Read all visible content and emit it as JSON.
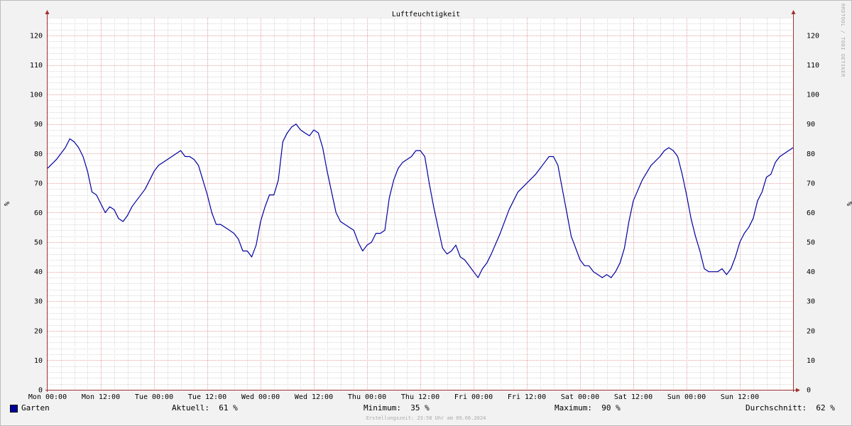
{
  "chart_data": {
    "type": "line",
    "title": "Luftfeuchtigkeit",
    "ylabel": "%",
    "ylim": [
      0,
      126
    ],
    "yticks": [
      0,
      10,
      20,
      30,
      40,
      50,
      60,
      70,
      80,
      90,
      100,
      110,
      120
    ],
    "x_tick_labels": [
      "Mon 00:00",
      "Mon 12:00",
      "Tue 00:00",
      "Tue 12:00",
      "Wed 00:00",
      "Wed 12:00",
      "Thu 00:00",
      "Thu 12:00",
      "Fri 00:00",
      "Fri 12:00",
      "Sat 00:00",
      "Sat 12:00",
      "Sun 00:00",
      "Sun 12:00"
    ],
    "x_unit": "hours since Mon 00:00",
    "xlim": [
      0,
      168
    ],
    "grid": true,
    "series": [
      {
        "name": "Garten",
        "color": "#0000a0",
        "points": [
          [
            0,
            75
          ],
          [
            2,
            78
          ],
          [
            4,
            82
          ],
          [
            5,
            85
          ],
          [
            6,
            84
          ],
          [
            7,
            82
          ],
          [
            8,
            79
          ],
          [
            9,
            74
          ],
          [
            10,
            67
          ],
          [
            11,
            66
          ],
          [
            12,
            63
          ],
          [
            13,
            60
          ],
          [
            14,
            62
          ],
          [
            15,
            61
          ],
          [
            16,
            58
          ],
          [
            17,
            57
          ],
          [
            18,
            59
          ],
          [
            19,
            62
          ],
          [
            20,
            64
          ],
          [
            22,
            68
          ],
          [
            24,
            74
          ],
          [
            25,
            76
          ],
          [
            27,
            78
          ],
          [
            29,
            80
          ],
          [
            30,
            81
          ],
          [
            31,
            79
          ],
          [
            32,
            79
          ],
          [
            33,
            78
          ],
          [
            34,
            76
          ],
          [
            35,
            71
          ],
          [
            36,
            66
          ],
          [
            37,
            60
          ],
          [
            38,
            56
          ],
          [
            39,
            56
          ],
          [
            40,
            55
          ],
          [
            41,
            54
          ],
          [
            42,
            53
          ],
          [
            43,
            51
          ],
          [
            44,
            47
          ],
          [
            45,
            47
          ],
          [
            46,
            45
          ],
          [
            47,
            49
          ],
          [
            48,
            57
          ],
          [
            49,
            62
          ],
          [
            50,
            66
          ],
          [
            51,
            66
          ],
          [
            52,
            71
          ],
          [
            53,
            84
          ],
          [
            54,
            87
          ],
          [
            55,
            89
          ],
          [
            56,
            90
          ],
          [
            57,
            88
          ],
          [
            58,
            87
          ],
          [
            59,
            86
          ],
          [
            60,
            88
          ],
          [
            61,
            87
          ],
          [
            62,
            82
          ],
          [
            63,
            74
          ],
          [
            64,
            67
          ],
          [
            65,
            60
          ],
          [
            66,
            57
          ],
          [
            67,
            56
          ],
          [
            68,
            55
          ],
          [
            69,
            54
          ],
          [
            70,
            50
          ],
          [
            71,
            47
          ],
          [
            72,
            49
          ],
          [
            73,
            50
          ],
          [
            74,
            53
          ],
          [
            75,
            53
          ],
          [
            76,
            54
          ],
          [
            77,
            65
          ],
          [
            78,
            71
          ],
          [
            79,
            75
          ],
          [
            80,
            77
          ],
          [
            82,
            79
          ],
          [
            83,
            81
          ],
          [
            84,
            81
          ],
          [
            85,
            79
          ],
          [
            86,
            70
          ],
          [
            87,
            62
          ],
          [
            88,
            55
          ],
          [
            89,
            48
          ],
          [
            90,
            46
          ],
          [
            91,
            47
          ],
          [
            92,
            49
          ],
          [
            93,
            45
          ],
          [
            94,
            44
          ],
          [
            95,
            42
          ],
          [
            96,
            40
          ],
          [
            97,
            38
          ],
          [
            98,
            41
          ],
          [
            99,
            43
          ],
          [
            100,
            46
          ],
          [
            102,
            53
          ],
          [
            104,
            61
          ],
          [
            106,
            67
          ],
          [
            108,
            70
          ],
          [
            110,
            73
          ],
          [
            112,
            77
          ],
          [
            113,
            79
          ],
          [
            114,
            79
          ],
          [
            115,
            76
          ],
          [
            116,
            68
          ],
          [
            117,
            60
          ],
          [
            118,
            52
          ],
          [
            119,
            48
          ],
          [
            120,
            44
          ],
          [
            121,
            42
          ],
          [
            122,
            42
          ],
          [
            123,
            40
          ],
          [
            124,
            39
          ],
          [
            125,
            38
          ],
          [
            126,
            39
          ],
          [
            127,
            38
          ],
          [
            128,
            40
          ],
          [
            129,
            43
          ],
          [
            130,
            48
          ],
          [
            131,
            57
          ],
          [
            132,
            64
          ],
          [
            134,
            71
          ],
          [
            136,
            76
          ],
          [
            138,
            79
          ],
          [
            139,
            81
          ],
          [
            140,
            82
          ],
          [
            141,
            81
          ],
          [
            142,
            79
          ],
          [
            143,
            73
          ],
          [
            144,
            66
          ],
          [
            145,
            58
          ],
          [
            146,
            52
          ],
          [
            147,
            47
          ],
          [
            148,
            41
          ],
          [
            149,
            40
          ],
          [
            150,
            40
          ],
          [
            151,
            40
          ],
          [
            152,
            41
          ],
          [
            153,
            39
          ],
          [
            154,
            41
          ],
          [
            155,
            45
          ],
          [
            156,
            50
          ],
          [
            157,
            53
          ],
          [
            158,
            55
          ],
          [
            159,
            58
          ],
          [
            160,
            64
          ],
          [
            161,
            67
          ],
          [
            162,
            72
          ],
          [
            163,
            73
          ],
          [
            164,
            77
          ],
          [
            165,
            79
          ],
          [
            167,
            81
          ],
          [
            168,
            82
          ]
        ]
      }
    ]
  },
  "legend": {
    "series_name": "Garten",
    "current": "Aktuell:  61 %",
    "minimum": "Minimum:  35 %",
    "maximum": "Maximum:  90 %",
    "average": "Durchschnitt:  62 %"
  },
  "credit": "RRDTOOL / TOBI OETIKER",
  "footer": "Erstellungszeit: 23:58 Uhr am 09.06.2024"
}
